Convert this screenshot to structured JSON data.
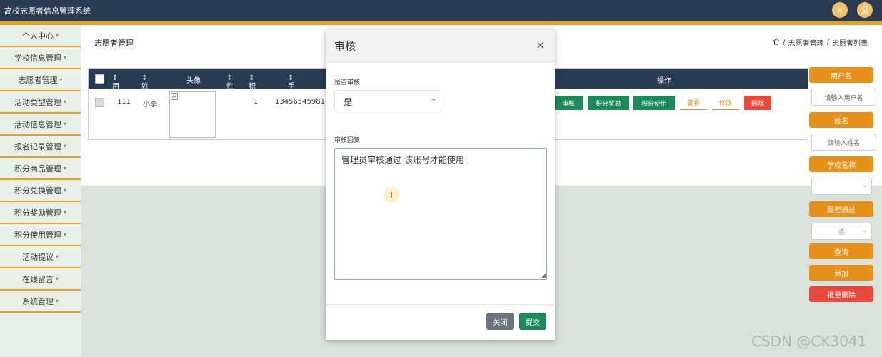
{
  "app": {
    "title": "高校志愿者信息管理系统",
    "icons": [
      "tools-icon",
      "user-icon"
    ],
    "accent": "#e8a317",
    "header_bg": "#293a53"
  },
  "sidebar": {
    "items": [
      {
        "label": "个人中心"
      },
      {
        "label": "学校信息管理"
      },
      {
        "label": "志愿者管理"
      },
      {
        "label": "活动类型管理"
      },
      {
        "label": "活动信息管理"
      },
      {
        "label": "报名记录管理"
      },
      {
        "label": "积分商品管理"
      },
      {
        "label": "积分兑换管理"
      },
      {
        "label": "积分奖励管理"
      },
      {
        "label": "积分使用管理"
      },
      {
        "label": "活动提议"
      },
      {
        "label": "在线留言"
      },
      {
        "label": "系统管理"
      }
    ]
  },
  "page": {
    "title": "志愿者管理",
    "breadcrumb": [
      "志愿者管理",
      "志愿者列表"
    ]
  },
  "table": {
    "columns": [
      "用户名",
      "姓名",
      "头像",
      "性别",
      "积分",
      "手机",
      "操作"
    ],
    "rows": [
      {
        "username": "111",
        "name": "小李",
        "points": "1",
        "phone": "13456545981"
      }
    ],
    "row_actions": [
      "审核",
      "积分奖励",
      "积分使用",
      "查看",
      "修改",
      "删除"
    ]
  },
  "search": {
    "username_label": "用户名",
    "username_placeholder": "请输入用户名",
    "name_label": "姓名",
    "name_placeholder": "请输入姓名",
    "school_label": "学校名称",
    "approved_label": "是否通过",
    "approved_value": "否",
    "query_button": "查询",
    "add_button": "添加",
    "batch_delete_button": "批量删除"
  },
  "modal": {
    "title": "审核",
    "close_symbol": "×",
    "audit_label": "是否审核",
    "audit_value": "是",
    "reply_label": "审核回复",
    "reply_value": "管理员审核通过 该账号才能使用",
    "close_button": "关闭",
    "submit_button": "提交"
  },
  "watermark": "CSDN @CK3041"
}
